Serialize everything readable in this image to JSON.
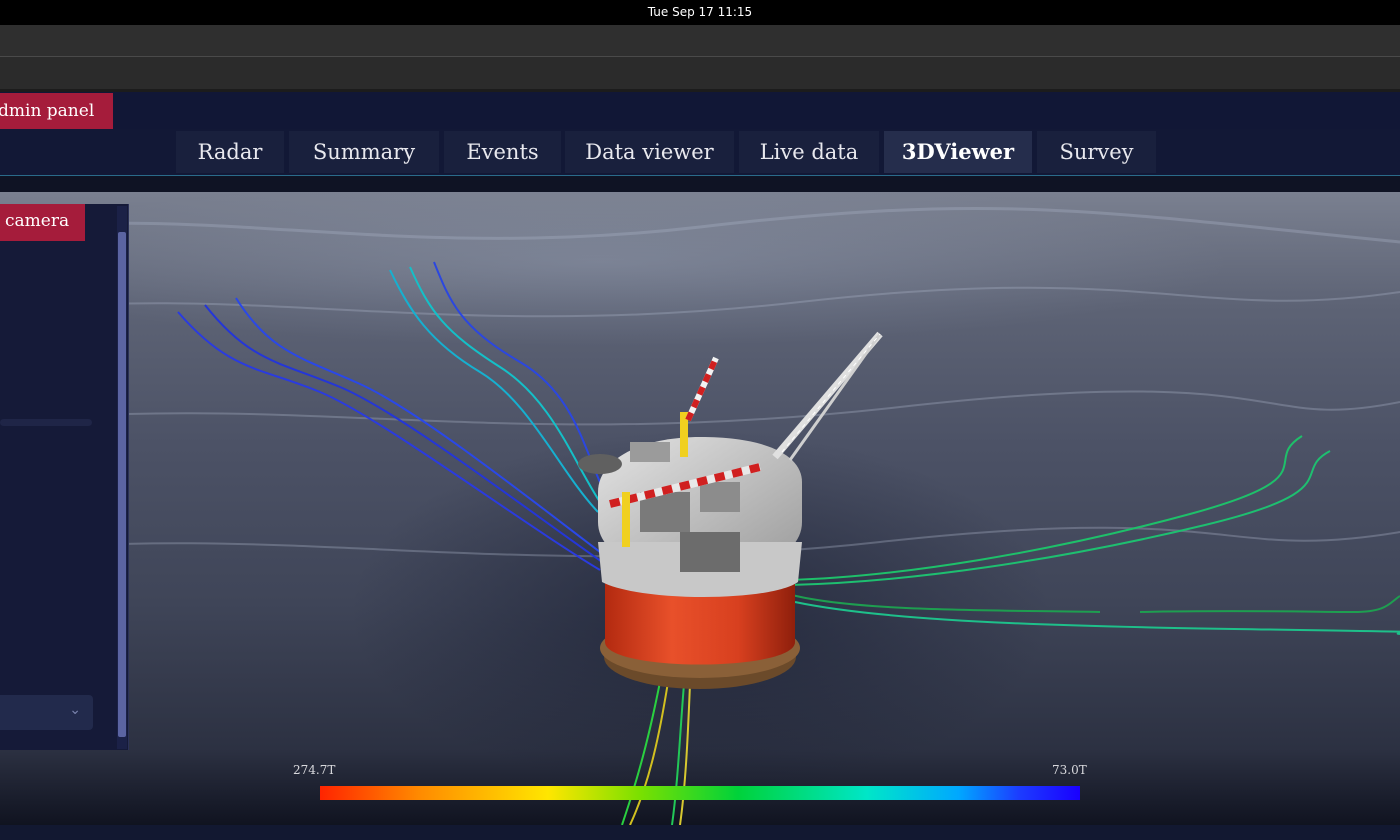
{
  "system": {
    "datetime": "Tue Sep 17  11:15"
  },
  "app": {
    "admin_tab": "dmin panel"
  },
  "nav": {
    "tabs": [
      {
        "label": "Radar",
        "active": false
      },
      {
        "label": "Summary",
        "active": false
      },
      {
        "label": "Events",
        "active": false
      },
      {
        "label": "Data viewer",
        "active": false
      },
      {
        "label": "Live data",
        "active": false
      },
      {
        "label": "3DViewer",
        "active": true
      },
      {
        "label": "Survey",
        "active": false
      }
    ]
  },
  "side_panel": {
    "camera_button": "camera",
    "select_icon": "chevron-down-icon"
  },
  "scale": {
    "max_label": "274.7T",
    "min_label": "73.0T"
  },
  "colors": {
    "accent_red": "#a51c3b",
    "nav_bg": "#121836",
    "hull_red": "#d8401f"
  }
}
